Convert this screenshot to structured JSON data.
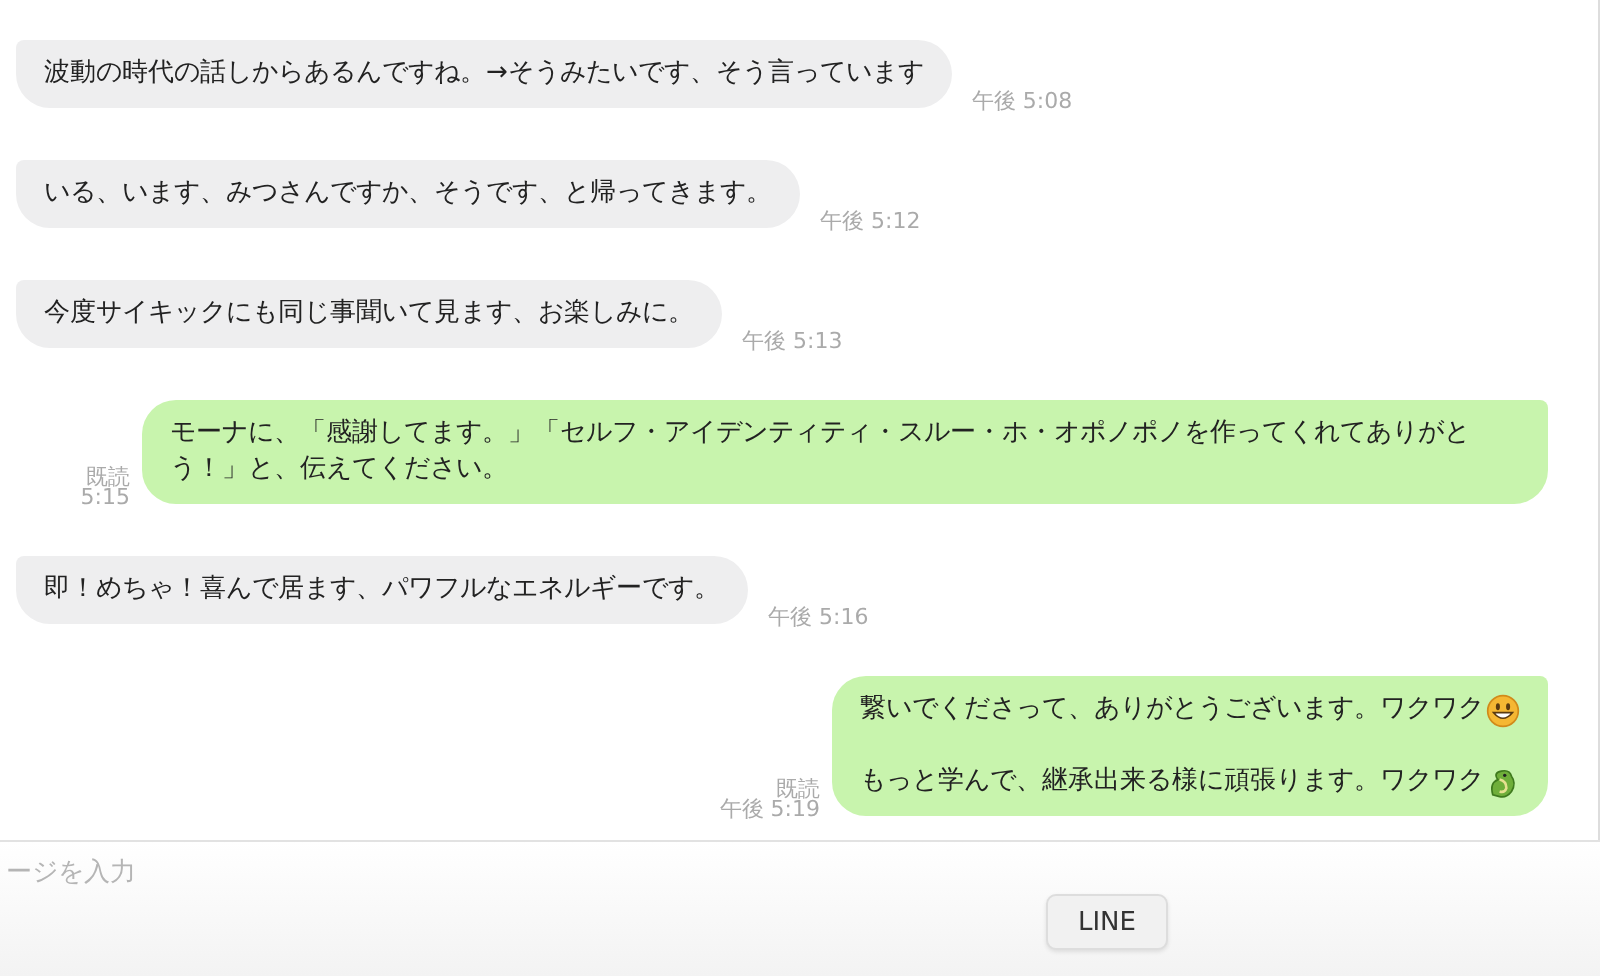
{
  "messages": [
    {
      "kind": "incoming",
      "text": "波動の時代の話しからあるんですね。→そうみたいです、そう言っています",
      "time": "午後 5:08"
    },
    {
      "kind": "incoming",
      "text": "いる、います、みつさんですか、そうです、と帰ってきます。",
      "time": "午後 5:12"
    },
    {
      "kind": "incoming",
      "text": "今度サイキックにも同じ事聞いて見ます、お楽しみに。",
      "time": "午後 5:13"
    },
    {
      "kind": "outgoing",
      "text": "モーナに、「感謝してます。」「セルフ・アイデンティティ・スルー・ホ・オポノポノを作ってくれてありがとう！」と、伝えてください。",
      "read": "既読",
      "time": "5:15"
    },
    {
      "kind": "incoming",
      "text": "即！めちゃ！喜んで居ます、パワフルなエネルギーです。",
      "time": "午後 5:16"
    },
    {
      "kind": "outgoing",
      "paragraphs": [
        "繋いでくださって、ありがとうございます。ワクワク",
        "もっと学んで、継承出来る様に頑張ります。ワクワク"
      ],
      "read": "既読",
      "time": "午後 5:19"
    }
  ],
  "input": {
    "placeholder": "ージを入力"
  },
  "tooltip": {
    "label": "LINE"
  }
}
